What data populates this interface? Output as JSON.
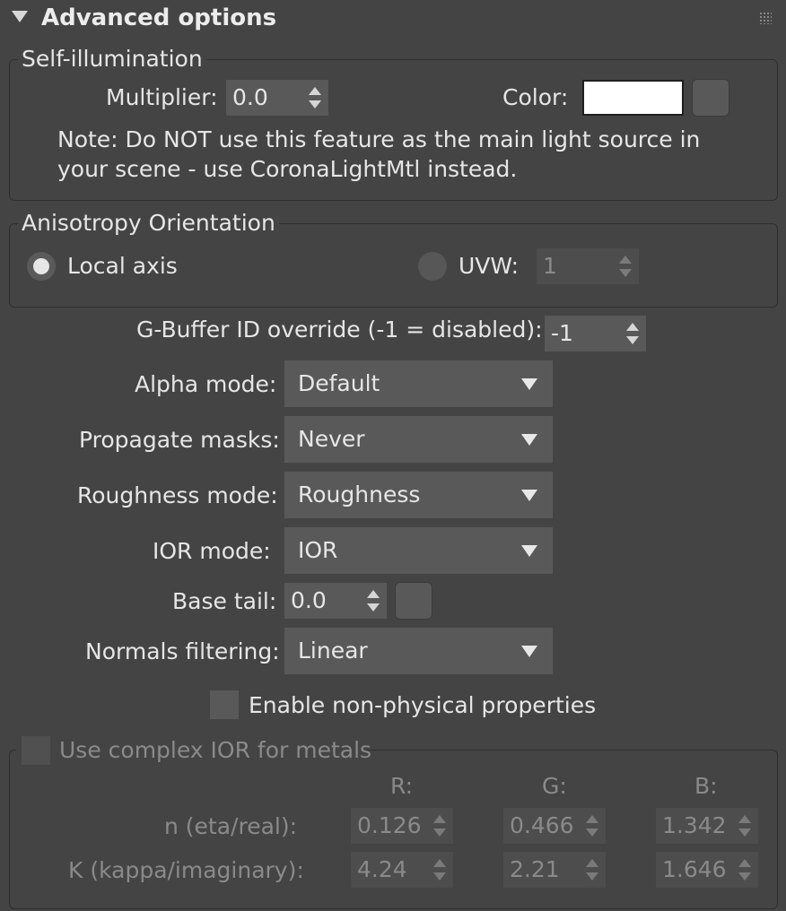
{
  "header": {
    "title": "Advanced options",
    "grip_icon": "drag-grip-icon"
  },
  "self_illumination": {
    "legend": "Self-illumination",
    "multiplier_label": "Multiplier:",
    "multiplier_value": "0.0",
    "color_label": "Color:",
    "color_value": "#ffffff",
    "note_line1": "Note: Do NOT use this feature as the main light source in",
    "note_line2": "your scene - use CoronaLightMtl instead."
  },
  "anisotropy": {
    "legend": "Anisotropy Orientation",
    "local_axis_label": "Local axis",
    "uvw_label": "UVW:",
    "uvw_value": "1",
    "selected": "Local axis"
  },
  "gbuffer": {
    "label": "G-Buffer ID override (-1 = disabled):",
    "value": "-1"
  },
  "alpha_mode": {
    "label": "Alpha mode:",
    "value": "Default"
  },
  "propagate_masks": {
    "label": "Propagate masks:",
    "value": "Never"
  },
  "roughness_mode": {
    "label": "Roughness mode:",
    "value": "Roughness"
  },
  "ior_mode": {
    "label": "IOR mode:",
    "value": "IOR"
  },
  "base_tail": {
    "label": "Base tail:",
    "value": "0.0"
  },
  "normals_filtering": {
    "label": "Normals filtering:",
    "value": "Linear"
  },
  "non_physical": {
    "label": "Enable non-physical properties",
    "checked": false
  },
  "complex_ior": {
    "legend": "Use complex IOR for metals",
    "checked": false,
    "col_r": "R:",
    "col_g": "G:",
    "col_b": "B:",
    "n_label": "n (eta/real):",
    "k_label": "K (kappa/imaginary):",
    "n_r": "0.126",
    "n_g": "0.466",
    "n_b": "1.342",
    "k_r": "4.24",
    "k_g": "2.21",
    "k_b": "1.646"
  }
}
